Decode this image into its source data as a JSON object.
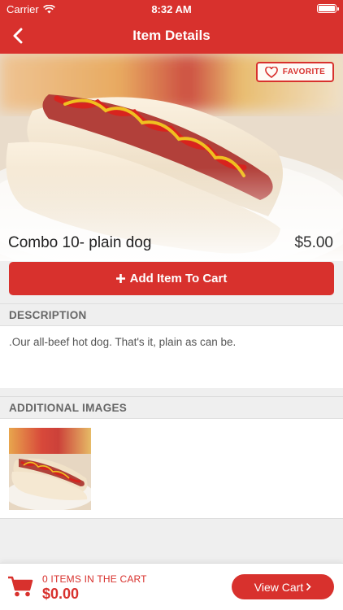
{
  "status_bar": {
    "carrier": "Carrier",
    "time": "8:32 AM"
  },
  "nav": {
    "title": "Item Details",
    "back_icon": "chevron-left-icon"
  },
  "product": {
    "name": "Combo 10- plain dog",
    "price": "$5.00",
    "favorite_label": "FAVORITE",
    "add_to_cart_label": "Add Item To Cart"
  },
  "description": {
    "header": "DESCRIPTION",
    "text": ".Our all-beef hot dog. That's it, plain as can be."
  },
  "additional_images": {
    "header": "ADDITIONAL IMAGES"
  },
  "cart": {
    "count_label": "0 ITEMS IN THE CART",
    "total": "$0.00",
    "view_cart_label": "View Cart"
  },
  "colors": {
    "brand": "#d8312d",
    "background": "#efefef"
  }
}
